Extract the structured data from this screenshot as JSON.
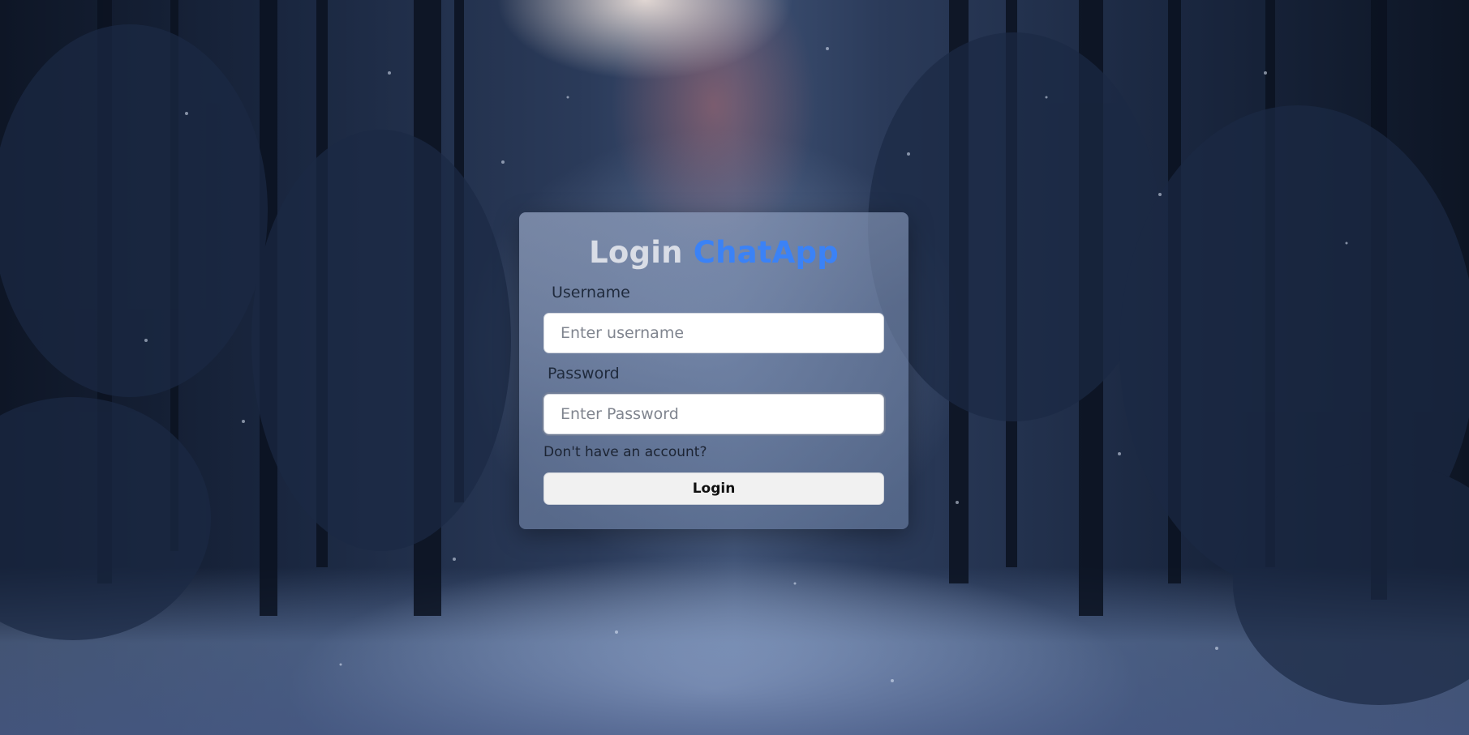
{
  "login_card": {
    "title_prefix": "Login",
    "title_brand": "ChatApp",
    "username_label": "Username",
    "username_placeholder": "Enter username",
    "username_value": "",
    "password_label": "Password",
    "password_placeholder": "Enter Password",
    "password_value": "",
    "signup_link": "Don't have an account?",
    "login_button": "Login"
  },
  "colors": {
    "brand": "#3b82f6",
    "card_background": "#8596b6",
    "button_background": "#f1f1f1"
  },
  "background": {
    "scene": "snowy-forest-night"
  }
}
